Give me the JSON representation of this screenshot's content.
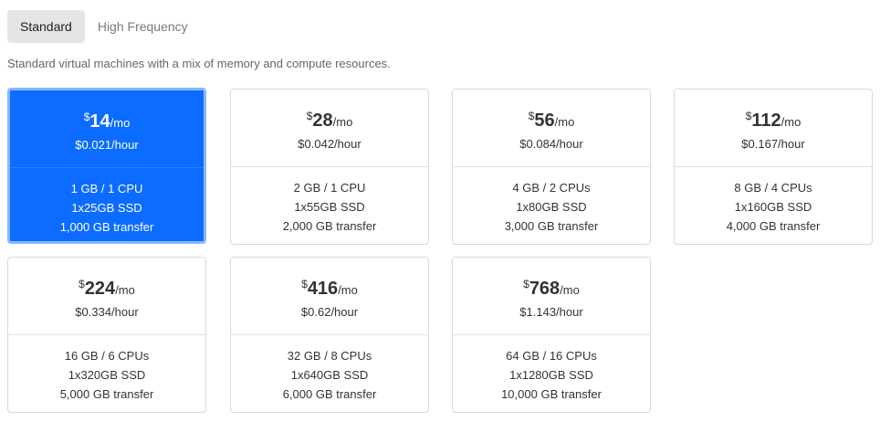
{
  "tabs": [
    {
      "label": "Standard",
      "active": true
    },
    {
      "label": "High Frequency",
      "active": false
    }
  ],
  "description": "Standard virtual machines with a mix of memory and compute resources.",
  "colors": {
    "selected": "#0b6cff",
    "selected_border": "#8ab7ff",
    "tab_active_bg": "#e5e5e5"
  },
  "plans": [
    {
      "currency": "$",
      "price": "14",
      "period": "/mo",
      "hourly": "$0.021/hour",
      "memory_cpu": "1 GB / 1 CPU",
      "storage": "1x25GB SSD",
      "transfer": "1,000 GB transfer",
      "selected": true
    },
    {
      "currency": "$",
      "price": "28",
      "period": "/mo",
      "hourly": "$0.042/hour",
      "memory_cpu": "2 GB / 1 CPU",
      "storage": "1x55GB SSD",
      "transfer": "2,000 GB transfer",
      "selected": false
    },
    {
      "currency": "$",
      "price": "56",
      "period": "/mo",
      "hourly": "$0.084/hour",
      "memory_cpu": "4 GB / 2 CPUs",
      "storage": "1x80GB SSD",
      "transfer": "3,000 GB transfer",
      "selected": false
    },
    {
      "currency": "$",
      "price": "112",
      "period": "/mo",
      "hourly": "$0.167/hour",
      "memory_cpu": "8 GB / 4 CPUs",
      "storage": "1x160GB SSD",
      "transfer": "4,000 GB transfer",
      "selected": false
    },
    {
      "currency": "$",
      "price": "224",
      "period": "/mo",
      "hourly": "$0.334/hour",
      "memory_cpu": "16 GB / 6 CPUs",
      "storage": "1x320GB SSD",
      "transfer": "5,000 GB transfer",
      "selected": false
    },
    {
      "currency": "$",
      "price": "416",
      "period": "/mo",
      "hourly": "$0.62/hour",
      "memory_cpu": "32 GB / 8 CPUs",
      "storage": "1x640GB SSD",
      "transfer": "6,000 GB transfer",
      "selected": false
    },
    {
      "currency": "$",
      "price": "768",
      "period": "/mo",
      "hourly": "$1.143/hour",
      "memory_cpu": "64 GB / 16 CPUs",
      "storage": "1x1280GB SSD",
      "transfer": "10,000 GB transfer",
      "selected": false
    }
  ]
}
